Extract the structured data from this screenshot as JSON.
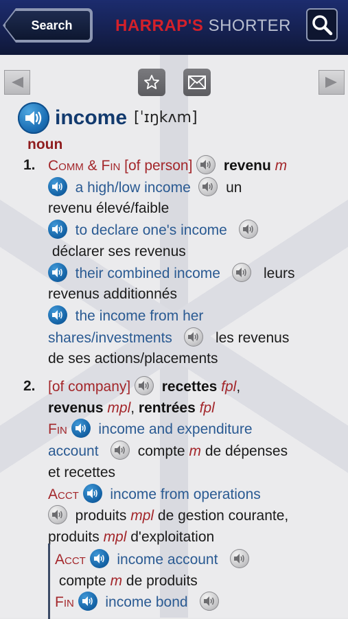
{
  "header": {
    "search_label": "Search",
    "brand_primary": "HARRAP'S",
    "brand_secondary": "SHORTER"
  },
  "entry": {
    "headword": "income",
    "pronunciation": "[ˈɪŋkʌm]",
    "pos": "noun",
    "sense1": {
      "num": "1.",
      "labels": "Comm & Fin",
      "context": "[of person]",
      "translation": "revenu",
      "gender": "m",
      "examples": [
        {
          "en": "a high/low income",
          "fr_a": "un",
          "fr_b": "revenu élevé/faible"
        },
        {
          "en": "to declare one's income",
          "fr": "déclarer ses revenus"
        },
        {
          "en": "their combined income",
          "fr_a": "leurs",
          "fr_b": "revenus additionnés"
        },
        {
          "en_a": "the income from her",
          "en_b": "shares/investments",
          "fr_a": "les revenus",
          "fr_b": "de ses actions/placements"
        }
      ]
    },
    "sense2": {
      "num": "2.",
      "context": "[of company]",
      "t1": "recettes",
      "g1": "fpl",
      "t2": "revenus",
      "g2": "mpl",
      "t3": "rentrées",
      "g3": "fpl",
      "ex1": {
        "label": "Fin",
        "en_a": "income and expenditure",
        "en_b": "account",
        "fr_a": "compte",
        "g": "m",
        "fr_b": "de dépenses",
        "fr_c": "et recettes"
      },
      "ex2": {
        "label": "Acct",
        "en": "income from operations",
        "fr_a": "produits",
        "g1": "mpl",
        "fr_b": "de gestion courante,",
        "fr_c": "produits",
        "g2": "mpl",
        "fr_d": "d'exploitation"
      },
      "sub1": {
        "label": "Acct",
        "en": "income account",
        "fr_a": "compte",
        "g": "m",
        "fr_b": "de produits"
      },
      "sub2": {
        "label": "Fin",
        "en": "income bond"
      }
    }
  },
  "icons": {
    "nav_prev": "left-triangle-icon",
    "nav_next": "right-triangle-icon",
    "favorite": "star-icon",
    "email": "envelope-icon",
    "search": "magnifier-icon",
    "audio": "speaker-icon"
  }
}
